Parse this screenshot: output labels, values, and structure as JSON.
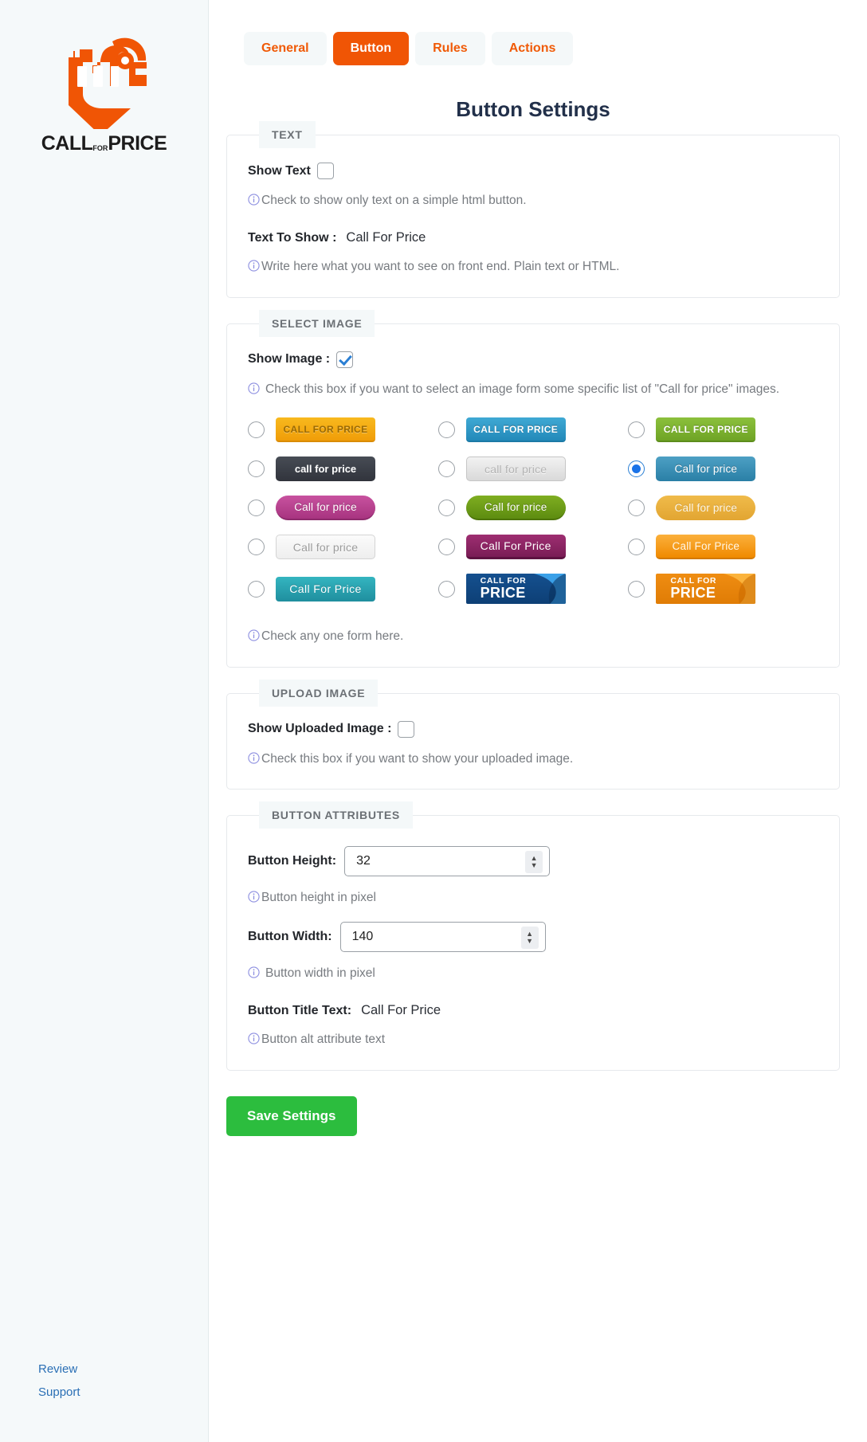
{
  "sidebar": {
    "logo": {
      "icon_name": "call-for-price-hand-phone-logo",
      "word_call": "CALL",
      "word_for": "FOR",
      "word_price": "PRICE",
      "brand_color": "#f05505"
    },
    "links": [
      {
        "label": "Review",
        "name": "sidebar-link-review"
      },
      {
        "label": "Support",
        "name": "sidebar-link-support"
      }
    ]
  },
  "tabs": [
    {
      "label": "General",
      "active": false
    },
    {
      "label": "Button",
      "active": true
    },
    {
      "label": "Rules",
      "active": false
    },
    {
      "label": "Actions",
      "active": false
    }
  ],
  "page_title": "Button Settings",
  "sections": {
    "text": {
      "legend": "TEXT",
      "show_text_label": "Show Text",
      "show_text_checked": false,
      "show_text_hint": "Check to show only text on a simple html button.",
      "text_to_show_label": "Text To Show :",
      "text_to_show_value": "Call For Price",
      "text_to_show_hint": "Write here what you want to see on front end. Plain text or HTML."
    },
    "select_image": {
      "legend": "SELECT IMAGE",
      "show_image_label": "Show Image :",
      "show_image_checked": true,
      "show_image_hint": "Check this box if you want to select an image form some specific list of \"Call for price\" images.",
      "grid_hint": "Check any one form here.",
      "selected_index": 5,
      "options": [
        {
          "text": "CALL FOR PRICE",
          "style": "sk1",
          "selected": false,
          "name": "image-option-orange-caps"
        },
        {
          "text": "CALL FOR PRICE",
          "style": "sk2",
          "selected": false,
          "name": "image-option-blue-caps"
        },
        {
          "text": "CALL FOR PRICE",
          "style": "sk3",
          "selected": false,
          "name": "image-option-green-caps"
        },
        {
          "text": "call for price",
          "style": "sk4",
          "selected": false,
          "name": "image-option-dark-lower"
        },
        {
          "text": "call for price",
          "style": "sk5",
          "selected": false,
          "name": "image-option-grey-lower"
        },
        {
          "text": "Call for price",
          "style": "sk6",
          "selected": true,
          "name": "image-option-steel-blue"
        },
        {
          "text": "Call for price",
          "style": "sk7",
          "selected": false,
          "name": "image-option-pink-pill"
        },
        {
          "text": "Call for price",
          "style": "sk8",
          "selected": false,
          "name": "image-option-green-pill"
        },
        {
          "text": "Call for price",
          "style": "sk9",
          "selected": false,
          "name": "image-option-yellow-pill"
        },
        {
          "text": "Call for price",
          "style": "sk10",
          "selected": false,
          "name": "image-option-light-grey"
        },
        {
          "text": "Call For Price",
          "style": "sk11",
          "selected": false,
          "name": "image-option-purple"
        },
        {
          "text": "Call For Price",
          "style": "sk12",
          "selected": false,
          "name": "image-option-amber"
        },
        {
          "text": "Call For Price",
          "style": "sk13",
          "selected": false,
          "name": "image-option-teal"
        },
        {
          "text": "CALL FOR|PRICE",
          "style": "rb-blue",
          "selected": false,
          "name": "image-option-blue-ribbon"
        },
        {
          "text": "CALL FOR|PRICE",
          "style": "rb-orange",
          "selected": false,
          "name": "image-option-orange-ribbon"
        }
      ]
    },
    "upload_image": {
      "legend": "UPLOAD IMAGE",
      "show_uploaded_label": "Show Uploaded Image :",
      "show_uploaded_checked": false,
      "hint": "Check this box if you want to show your uploaded image."
    },
    "button_attributes": {
      "legend": "BUTTON ATTRIBUTES",
      "height_label": "Button Height:",
      "height_value": "32",
      "height_hint": "Button height in pixel",
      "width_label": "Button Width:",
      "width_value": "140",
      "width_hint": "Button width in pixel",
      "title_label": "Button Title Text:",
      "title_value": "Call For Price",
      "title_hint": "Button alt attribute text"
    }
  },
  "save": {
    "label": "Save Settings",
    "color": "#2cbd3e"
  }
}
